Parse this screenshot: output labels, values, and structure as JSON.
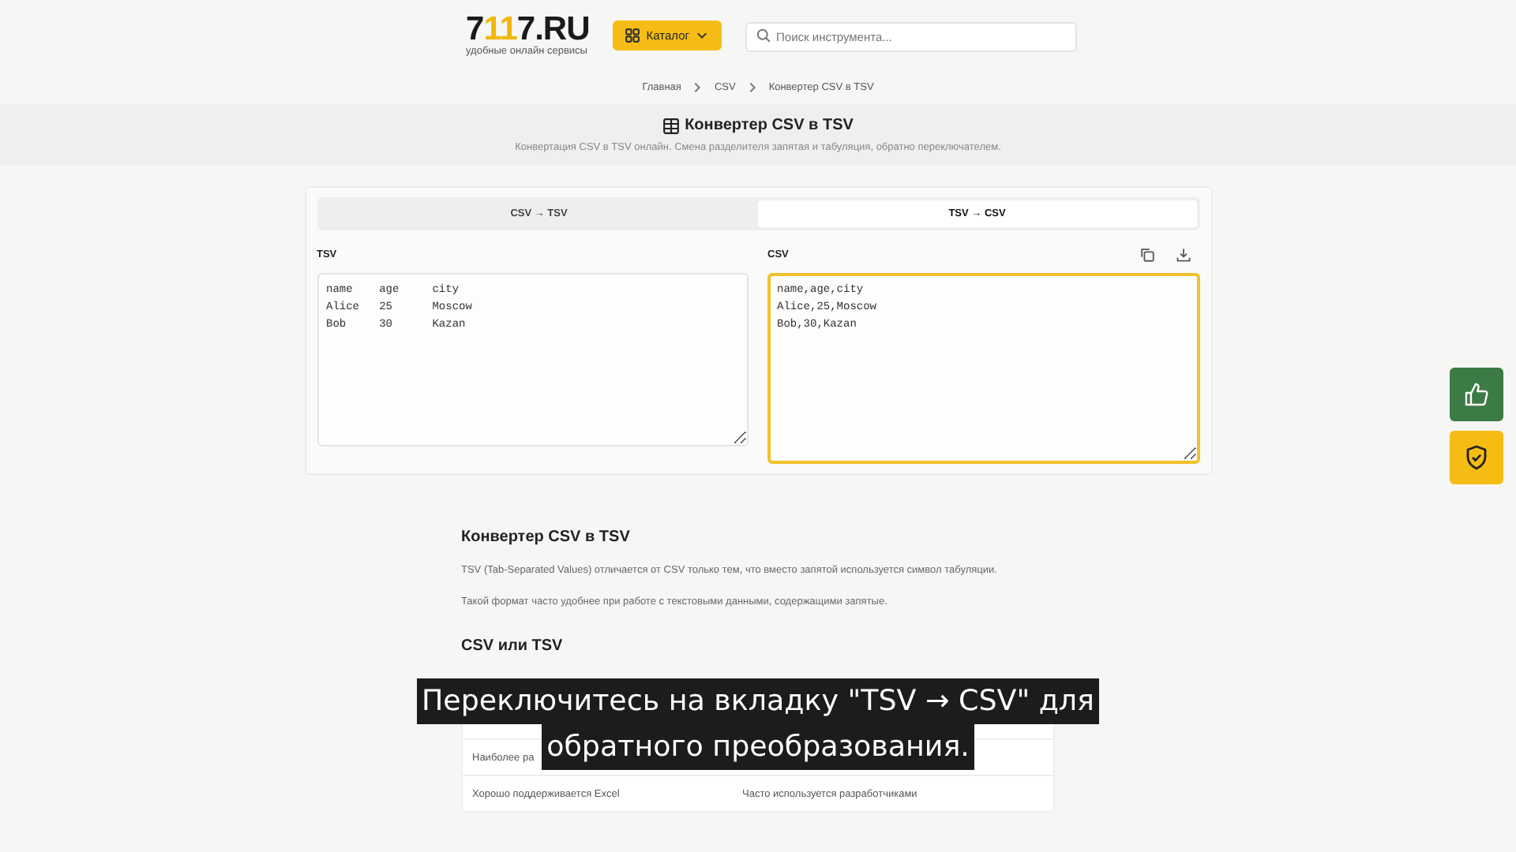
{
  "header": {
    "logo_prefix": "7",
    "logo_accent": "11",
    "logo_suffix": "7.RU",
    "tagline": "удобные онлайн сервисы",
    "catalog_button": "Каталог",
    "search": {
      "placeholder": "Поиск инструмента..."
    }
  },
  "breadcrumbs": [
    "Главная",
    "CSV",
    "Конвертер CSV в TSV"
  ],
  "page": {
    "title": "Конвертер CSV в TSV",
    "subtitle": "Конвертация CSV в TSV онлайн. Смена разделителя запятая и табуляция, обратно переключателем."
  },
  "tabs": [
    {
      "label": "CSV → TSV",
      "selected": false
    },
    {
      "label": "TSV → CSV",
      "selected": true
    }
  ],
  "panes": [
    {
      "label": "TSV",
      "value": "name\tage\tcity\nAlice\t25\tMoscow\nBob\t30\tKazan",
      "focused": false,
      "actions": false
    },
    {
      "label": "CSV",
      "value": "name,age,city\nAlice,25,Moscow\nBob,30,Kazan",
      "focused": true,
      "actions": true
    }
  ],
  "article": {
    "heading": "Конвертер CSV в TSV",
    "paragraphs": [
      "TSV (Tab-Separated Values) отличается от CSV только тем, что вместо запятой используется символ табуляции.",
      "Такой формат часто удобнее при работе с текстовыми данными, содержащими запятые."
    ],
    "subheading": "CSV или TSV",
    "table_rows": [
      [
        "Наиболее ра"
      ],
      [
        "Хорошо поддерживается Excel",
        "Часто используется разработчиками"
      ]
    ]
  },
  "caption": [
    "Переключитесь на вкладку \"TSV → CSV\" для",
    "обратного преобразования."
  ]
}
